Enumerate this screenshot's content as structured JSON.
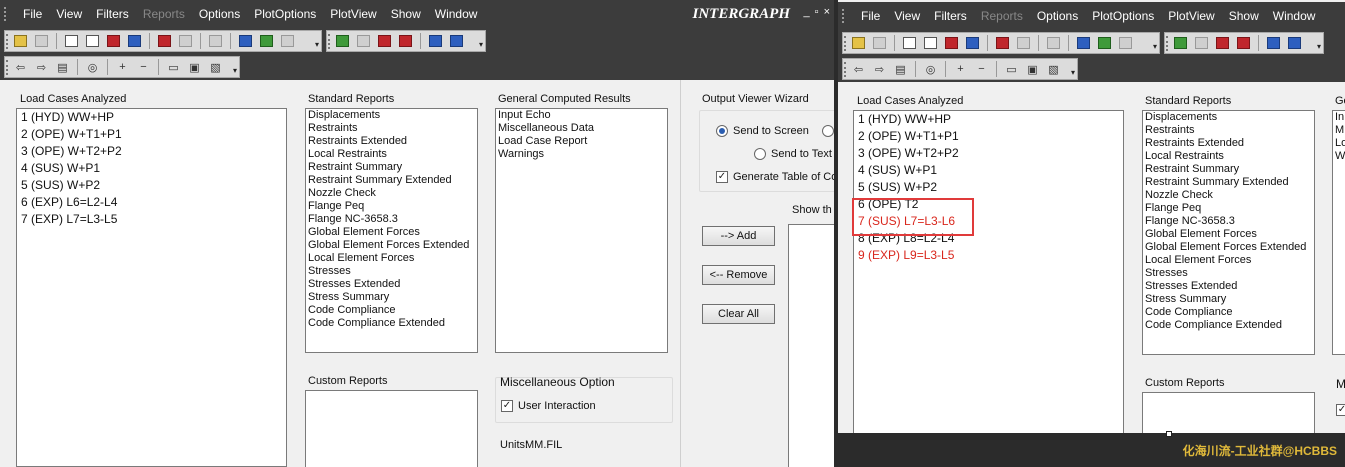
{
  "menu": [
    "File",
    "View",
    "Filters",
    "Reports",
    "Options",
    "PlotOptions",
    "PlotView",
    "Show",
    "Window"
  ],
  "menu_disabled": "Reports",
  "brand": "INTERGRAPH",
  "window_controls": [
    "_",
    "▫",
    "×"
  ],
  "left": {
    "load_cases_label": "Load Cases Analyzed",
    "load_cases": [
      "1 (HYD) WW+HP",
      "2 (OPE) W+T1+P1",
      "3 (OPE) W+T2+P2",
      "4 (SUS) W+P1",
      "5 (SUS) W+P2",
      "6 (EXP) L6=L2-L4",
      "7 (EXP) L7=L3-L5"
    ],
    "standard_reports_label": "Standard Reports",
    "standard_reports": [
      "Displacements",
      "Restraints",
      "Restraints Extended",
      "Local Restraints",
      "Restraint Summary",
      "Restraint Summary Extended",
      "Nozzle Check",
      "Flange Peq",
      "Flange NC-3658.3",
      "Global Element Forces",
      "Global Element Forces Extended",
      "Local Element Forces",
      "Stresses",
      "Stresses Extended",
      "Stress Summary",
      "Code Compliance",
      "Code Compliance Extended"
    ],
    "general_results_label": "General Computed Results",
    "general_results": [
      "Input Echo",
      "Miscellaneous Data",
      "Load Case Report",
      "Warnings"
    ],
    "custom_reports_label": "Custom Reports",
    "misc_label": "Miscellaneous Option",
    "user_interaction": "User Interaction",
    "units_label": "Units:",
    "units_value": "MM.FIL",
    "wizard_label": "Output Viewer Wizard",
    "send_to_screen": "Send to Screen",
    "send_to_text": "Send to Text",
    "generate_toc": "Generate Table of Co",
    "show_the": "Show th",
    "add_button": "--> Add",
    "remove_button": "<-- Remove",
    "clear_all_button": "Clear All"
  },
  "right": {
    "load_cases_label": "Load Cases Analyzed",
    "load_cases": [
      {
        "text": "1 (HYD) WW+HP",
        "color": "#111111"
      },
      {
        "text": "2 (OPE) W+T1+P1",
        "color": "#111111"
      },
      {
        "text": "3 (OPE) W+T2+P2",
        "color": "#111111"
      },
      {
        "text": "4 (SUS) W+P1",
        "color": "#111111"
      },
      {
        "text": "5 (SUS) W+P2",
        "color": "#111111"
      },
      {
        "text": "6 (OPE) T2",
        "color": "#111111"
      },
      {
        "text": "7 (SUS) L7=L3-L6",
        "color": "#d9261c"
      },
      {
        "text": "8 (EXP) L8=L2-L4",
        "color": "#111111"
      },
      {
        "text": "9 (EXP) L9=L3-L5",
        "color": "#d9261c"
      }
    ],
    "standard_reports_label": "Standard Reports",
    "standard_reports": [
      "Displacements",
      "Restraints",
      "Restraints Extended",
      "Local Restraints",
      "Restraint Summary",
      "Restraint Summary Extended",
      "Nozzle Check",
      "Flange Peq",
      "Flange NC-3658.3",
      "Global Element Forces",
      "Global Element Forces Extended",
      "Local Element Forces",
      "Stresses",
      "Stresses Extended",
      "Stress Summary",
      "Code Compliance",
      "Code Compliance Extended"
    ],
    "general_results_label_partial": "Ge",
    "general_results_partial": [
      "In",
      "M",
      "Lo",
      "W"
    ],
    "custom_reports_label": "Custom Reports",
    "misc_label_partial": "M"
  },
  "watermark": "化海川流-工业社群@HCBBS"
}
